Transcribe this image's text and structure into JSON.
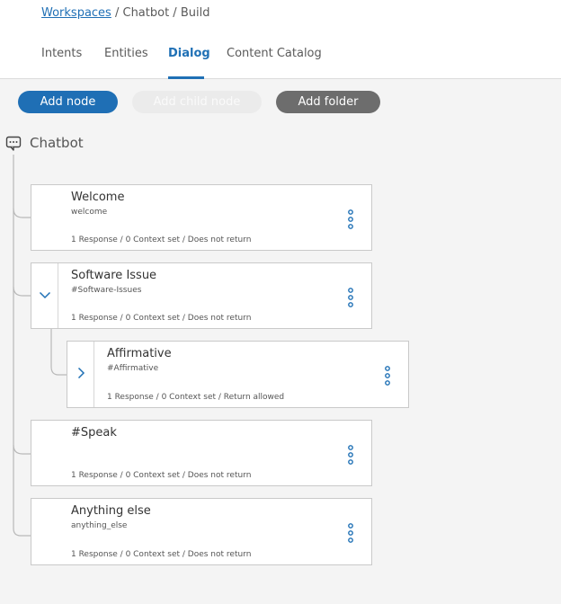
{
  "breadcrumb": {
    "workspaces": "Workspaces",
    "rest": " / Chatbot / Build"
  },
  "tabs": [
    {
      "label": "Intents",
      "active": false
    },
    {
      "label": "Entities",
      "active": false
    },
    {
      "label": "Dialog",
      "active": true
    },
    {
      "label": "Content Catalog",
      "active": false
    }
  ],
  "toolbar": {
    "add_node": "Add node",
    "add_child_node": "Add child node",
    "add_folder": "Add folder"
  },
  "root": {
    "label": "Chatbot",
    "icon": "chat-bubble-icon"
  },
  "nodes": [
    {
      "title": "Welcome",
      "condition": "welcome",
      "meta": "1 Response / 0 Context set / Does not return",
      "toggle": null
    },
    {
      "title": "Software Issue",
      "condition": "#Software-Issues",
      "meta": "1 Response / 0 Context set / Does not return",
      "toggle": "chevron-down-icon"
    },
    {
      "title": "Affirmative",
      "condition": "#Affirmative",
      "meta": "1 Response / 0 Context set / Return allowed",
      "toggle": "chevron-right-icon"
    },
    {
      "title": "#Speak",
      "condition": "",
      "meta": "1 Response / 0 Context set / Does not return",
      "toggle": null
    },
    {
      "title": "Anything else",
      "condition": "anything_else",
      "meta": "1 Response / 0 Context set / Does not return",
      "toggle": null
    }
  ],
  "colors": {
    "accent": "#1f70b5",
    "secondary_button": "#6d6d6d",
    "background": "#f4f4f4"
  }
}
